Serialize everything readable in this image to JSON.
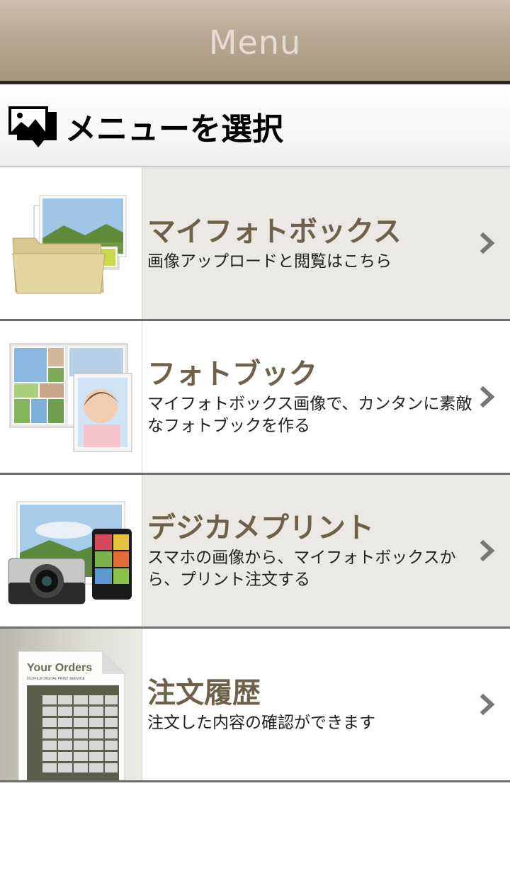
{
  "header": {
    "title": "Menu"
  },
  "section": {
    "title": "メニューを選択",
    "icon": "photos-stack-icon"
  },
  "menu": [
    {
      "title": "マイフォトボックス",
      "subtitle": "画像アップロードと閲覧はこちら",
      "icon": "photo-folder-icon"
    },
    {
      "title": "フォトブック",
      "subtitle": "マイフォトボックス画像で、カンタンに素敵なフォトブックを作る",
      "icon": "photobook-icon"
    },
    {
      "title": "デジカメプリント",
      "subtitle": "スマホの画像から、マイフォトボックスから、プリント注文する",
      "icon": "camera-prints-icon"
    },
    {
      "title": "注文履歴",
      "subtitle": "注文した内容の確認ができます",
      "icon": "orders-document-icon",
      "thumb_title": "Your Orders",
      "thumb_caption": "FUJIFILM DIGITAL PRINT SERVICE"
    }
  ],
  "colors": {
    "header_bg": "#b9a994",
    "header_text": "#e4ddd4",
    "item_title": "#6f6049",
    "shade_bg": "#ebe9e5",
    "chevron": "#777777"
  }
}
